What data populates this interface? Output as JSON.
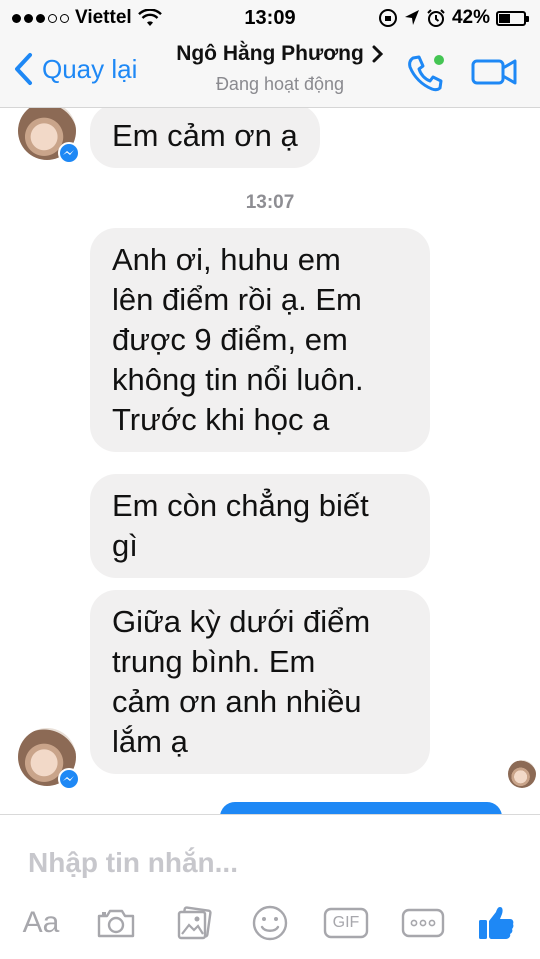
{
  "status_bar": {
    "carrier": "Viettel",
    "time": "13:09",
    "battery": "42%"
  },
  "header": {
    "back_label": "Quay lại",
    "contact_name": "Ngô Hằng Phương",
    "contact_status": "Đang hoạt động"
  },
  "chat": {
    "messages": [
      {
        "text": "Em cảm ơn ạ"
      },
      {
        "text": "Anh ơi, huhu em\nlên điểm rồi ạ. Em\nđược 9 điểm, em\nkhông tin nổi luôn.\nTrước khi học a"
      },
      {
        "text": "Em còn chẳng biết\ngì"
      },
      {
        "text": "Giữa kỳ dưới điểm\ntrung bình. Em\ncảm ơn anh nhiều\nlắm ạ"
      }
    ],
    "timestamp": "13:07"
  },
  "composer": {
    "placeholder": "Nhập tin nhắn...",
    "aa_label": "Aa",
    "gif_label": "GIF"
  },
  "colors": {
    "accent": "#1e88f5",
    "bubble_bg": "#f1f0f0",
    "online": "#44c553"
  }
}
